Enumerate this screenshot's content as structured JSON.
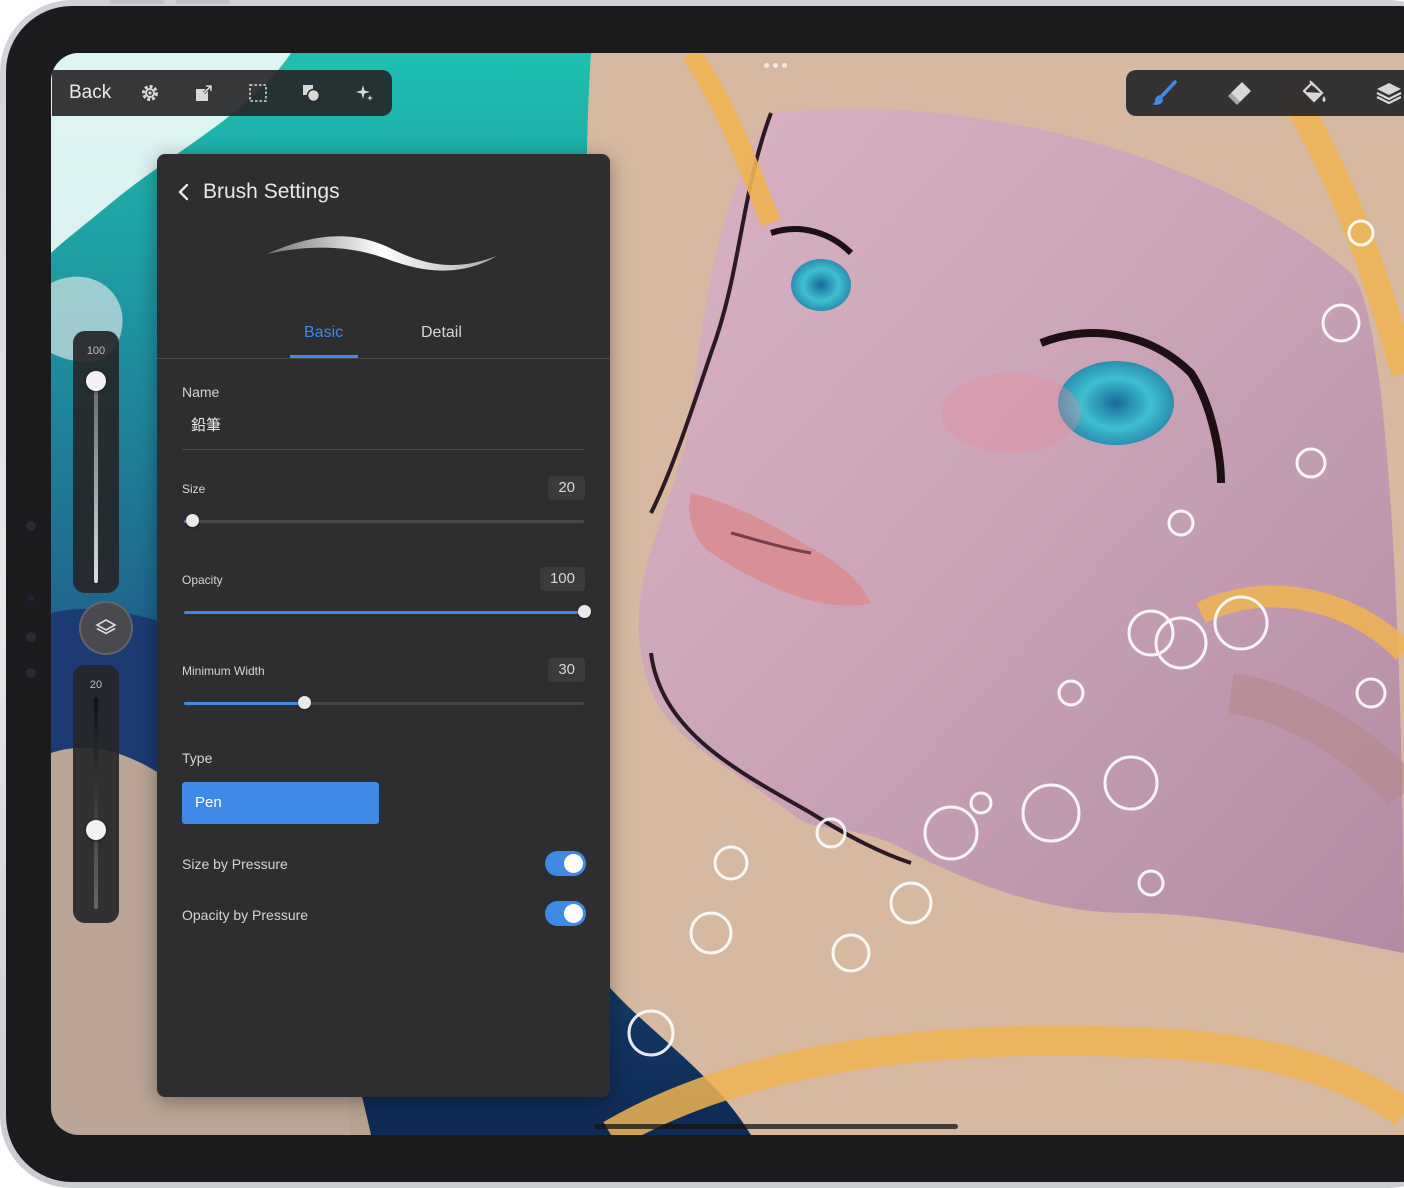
{
  "toolbar_left": {
    "back_label": "Back",
    "icons": [
      "gear-icon",
      "transform-icon",
      "selection-icon",
      "shapes-icon",
      "sparkle-icon"
    ]
  },
  "toolbar_right": {
    "icons": [
      "brush-icon",
      "eraser-icon",
      "fill-bucket-icon",
      "layers-icon"
    ],
    "active_tool": "brush-icon",
    "accent_color": "#3f8ae6"
  },
  "side_sliders": {
    "opacity_value": "100",
    "size_value": "20"
  },
  "brush_panel": {
    "title": "Brush Settings",
    "tabs": [
      {
        "label": "Basic",
        "active": true
      },
      {
        "label": "Detail",
        "active": false
      }
    ],
    "name_label": "Name",
    "name_value": "鉛筆",
    "size": {
      "label": "Size",
      "value": "20",
      "fraction": 0.02
    },
    "opacity": {
      "label": "Opacity",
      "value": "100",
      "fraction": 1.0
    },
    "min_width": {
      "label": "Minimum Width",
      "value": "30",
      "fraction": 0.3
    },
    "type_label": "Type",
    "type_value": "Pen",
    "size_by_pressure": {
      "label": "Size by Pressure",
      "on": true
    },
    "opacity_by_pressure": {
      "label": "Opacity by Pressure",
      "on": true
    }
  },
  "colors": {
    "panel_bg": "#2e2e30",
    "accent": "#3f8ae6",
    "toolbar_bg": "#262628"
  }
}
